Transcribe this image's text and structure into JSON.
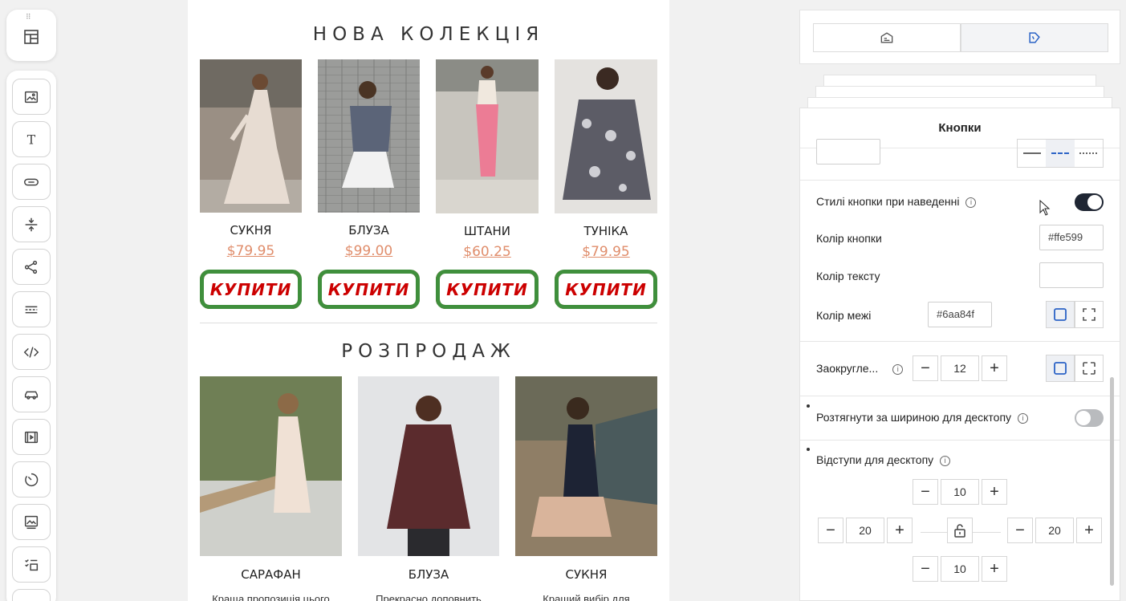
{
  "toolbar": {
    "top_icon": "layout-icon",
    "items": [
      {
        "name": "image-block",
        "icon": "image-icon"
      },
      {
        "name": "text-block",
        "icon": "text-icon"
      },
      {
        "name": "button-block",
        "icon": "button-icon"
      },
      {
        "name": "spacer-block",
        "icon": "spacer-icon"
      },
      {
        "name": "social-block",
        "icon": "share-icon"
      },
      {
        "name": "divider-block",
        "icon": "divider-icon"
      },
      {
        "name": "html-block",
        "icon": "code-icon"
      },
      {
        "name": "product-block",
        "icon": "car-icon"
      },
      {
        "name": "video-block",
        "icon": "video-icon"
      },
      {
        "name": "timer-block",
        "icon": "timer-icon"
      },
      {
        "name": "banner-block",
        "icon": "banner-icon"
      },
      {
        "name": "menu-block",
        "icon": "list-icon"
      }
    ]
  },
  "email": {
    "new_collection": {
      "title": "НОВА КОЛЕКЦІЯ",
      "products": [
        {
          "name": "СУКНЯ",
          "price": "$79.95",
          "button": "КУПИТИ"
        },
        {
          "name": "БЛУЗА",
          "price": "$99.00",
          "button": "КУПИТИ"
        },
        {
          "name": "ШТАНИ",
          "price": "$60.25",
          "button": "КУПИТИ"
        },
        {
          "name": "ТУНІКА",
          "price": "$79.95",
          "button": "КУПИТИ"
        }
      ]
    },
    "sale": {
      "title": "РОЗПРОДАЖ",
      "products": [
        {
          "name": "САРАФАН",
          "desc": "Краща пропозиція цього"
        },
        {
          "name": "БЛУЗА",
          "desc": "Прекрасно доповнить"
        },
        {
          "name": "СУКНЯ",
          "desc": "Кращий вибір для"
        }
      ]
    }
  },
  "panel": {
    "tabs": [
      {
        "icon": "blocks-icon"
      },
      {
        "icon": "style-icon"
      }
    ],
    "title": "Кнопки",
    "hover_styles": {
      "label": "Стилі кнопки при наведенні",
      "enabled": true
    },
    "button_color": {
      "label": "Колір кнопки",
      "value": "#ffe599"
    },
    "text_color": {
      "label": "Колір тексту",
      "value": ""
    },
    "border_color": {
      "label": "Колір межі",
      "value": "#6aa84f"
    },
    "rounding": {
      "label": "Заокругле...",
      "value": "12"
    },
    "stretch": {
      "label": "Розтягнути за шириною для десктопу",
      "enabled": false
    },
    "padding": {
      "label": "Відступи для десктопу",
      "top": "10",
      "left": "20",
      "right": "20",
      "bottom": "10"
    },
    "colors": {
      "accent": "#1f2633",
      "price": "#e08d6b",
      "button_text": "#cc0000",
      "button_border_red": "#c81414",
      "button_border_green": "#3f8f3c",
      "segment_blue": "#2b63c6"
    }
  }
}
